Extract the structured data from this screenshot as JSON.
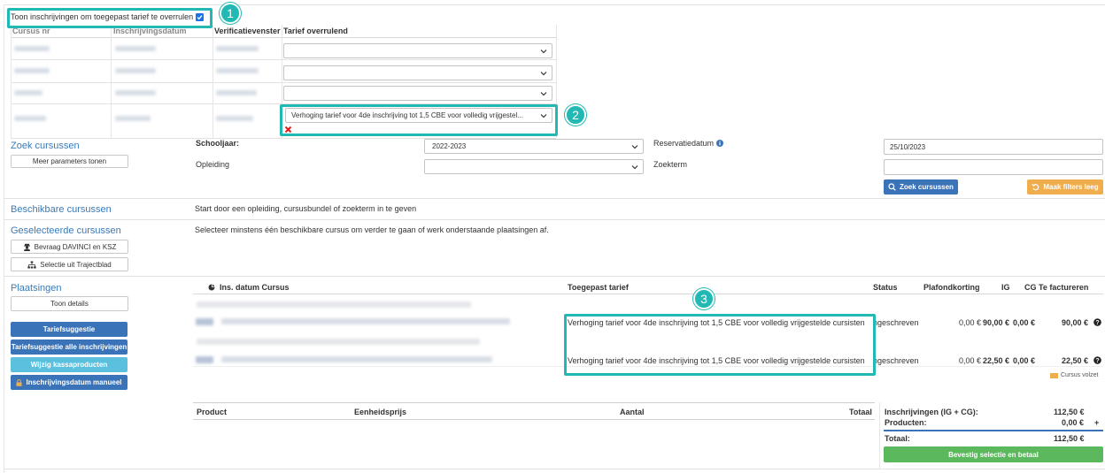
{
  "override": {
    "checkbox_label": "Toon inschrijvingen om toegepast tarief te overrulen",
    "checked": true,
    "columns": [
      "Cursus nr",
      "Inschrijvingsdatum",
      "Verificatievenster",
      "Tarief overrulend"
    ],
    "selected_tariff": "Verhoging tarief voor 4de inschrijving tot 1,5 CBE voor volledig vrijgestel..."
  },
  "callouts": [
    "1",
    "2",
    "3"
  ],
  "search": {
    "title": "Zoek cursussen",
    "more_params": "Meer parameters tonen",
    "schooljaar_label": "Schooljaar:",
    "schooljaar_value": "2022-2023",
    "opleiding_label": "Opleiding",
    "reservatiedatum_label": "Reservatiedatum",
    "reservatiedatum_value": "25/10/2023",
    "zoekterm_label": "Zoekterm",
    "search_button": "Zoek cursussen",
    "clear_button": "Maak filters leeg"
  },
  "available": {
    "title": "Beschikbare cursussen",
    "message": "Start door een opleiding, cursusbundel of zoekterm in te geven"
  },
  "selected": {
    "title": "Geselecteerde cursussen",
    "message": "Selecteer minstens één beschikbare cursus om verder te gaan of werk onderstaande plaatsingen af.",
    "btn_davinci": "Bevraag DAVINCI en KSZ",
    "btn_trajectblad": "Selectie uit Trajectblad"
  },
  "placements": {
    "title": "Plaatsingen",
    "toon_details": "Toon details",
    "btn_tariefsuggestie": "Tariefsuggestie",
    "btn_tariefsuggestie_alle": "Tariefsuggestie alle inschrijvingen",
    "btn_wijzig_kassa": "Wijzig kassaproducten",
    "btn_inschrijvingsdatum": "Inschrijvingsdatum manueel",
    "headers": {
      "ins_datum": "Ins. datum Cursus",
      "tarief": "Toegepast tarief",
      "status": "Status",
      "plafond": "Plafondkorting",
      "ig": "IG",
      "cg": "CG",
      "te_factureren": "Te factureren"
    },
    "rows": [
      {
        "tarief": "Verhoging tarief voor 4de inschrijving tot 1,5 CBE voor volledig vrijgestelde cursisten",
        "status": "ngeschreven",
        "plafond": "0,00 €",
        "ig": "90,00 €",
        "cg": "0,00 €",
        "factureren": "90,00 €"
      },
      {
        "tarief": "Verhoging tarief voor 4de inschrijving tot 1,5 CBE voor volledig vrijgestelde cursisten",
        "status": "ngeschreven",
        "plafond": "0,00 €",
        "ig": "22,50 €",
        "cg": "0,00 €",
        "factureren": "22,50 €"
      }
    ],
    "legend_volzet": "Cursus volzet"
  },
  "products": {
    "headers": [
      "Product",
      "Eenheidsprijs",
      "Aantal",
      "Totaal"
    ]
  },
  "totals": {
    "inschrijvingen_label": "Inschrijvingen (IG + CG):",
    "inschrijvingen_value": "112,50 €",
    "producten_label": "Producten:",
    "producten_value": "0,00 €",
    "producten_plus": "+",
    "totaal_label": "Totaal:",
    "totaal_value": "112,50 €",
    "confirm_button": "Bevestig selectie en betaal"
  },
  "colors": {
    "accent": "#3a73b8",
    "callout": "#22b9b4",
    "success": "#5cb85c",
    "warning": "#f0ad4e",
    "info": "#5bc0de",
    "error": "#e02020"
  }
}
